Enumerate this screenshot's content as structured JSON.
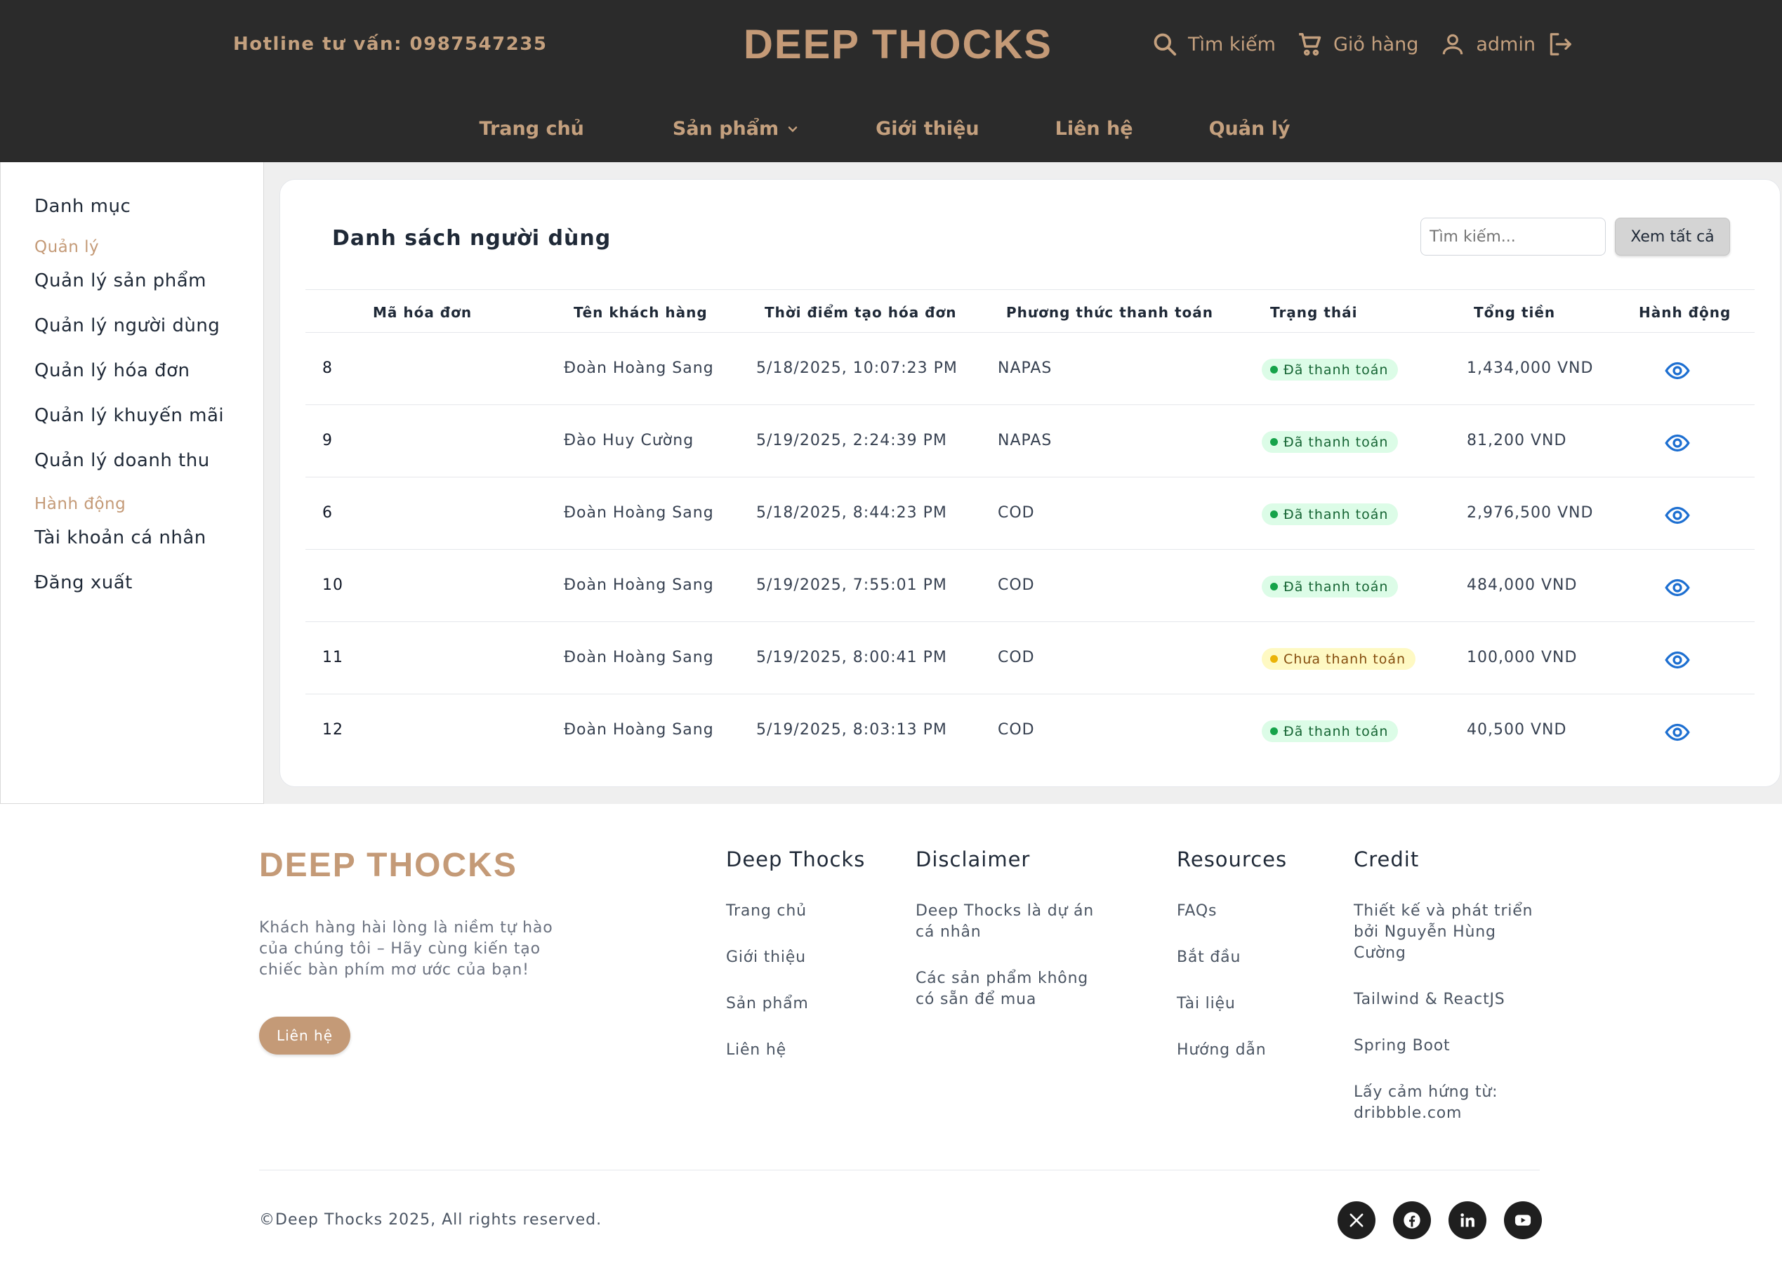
{
  "header": {
    "hotline_label": "Hotline tư vấn: ",
    "hotline_number": "0987547235",
    "brand": "DEEP THOCKS",
    "search_label": "Tìm kiếm",
    "cart_label": "Giỏ hàng",
    "user_label": "admin"
  },
  "nav": {
    "home": "Trang chủ",
    "products": "Sản phẩm",
    "about": "Giới thiệu",
    "contact": "Liên hệ",
    "manage": "Quản lý"
  },
  "sidebar": {
    "title": "Danh mục",
    "cat_manage": "Quản lý",
    "items": [
      "Quản lý sản phẩm",
      "Quản lý người dùng",
      "Quản lý hóa đơn",
      "Quản lý khuyến mãi",
      "Quản lý doanh thu"
    ],
    "cat_actions": "Hành động",
    "actions": [
      "Tài khoản cá nhân",
      "Đăng xuất"
    ]
  },
  "main": {
    "title": "Danh sách người dùng",
    "search_placeholder": "Tìm kiếm...",
    "view_all": "Xem tất cả",
    "columns": [
      "Mã hóa đơn",
      "Tên khách hàng",
      "Thời điểm tạo hóa đơn",
      "Phương thức thanh toán",
      "Trạng thái",
      "Tổng tiền",
      "Hành động"
    ],
    "rows": [
      {
        "id": "8",
        "customer": "Đoàn Hoàng Sang",
        "created": "5/18/2025, 10:07:23 PM",
        "method": "NAPAS",
        "status": "Đã thanh toán",
        "paid": true,
        "total": "1,434,000 VND"
      },
      {
        "id": "9",
        "customer": "Đào Huy Cường",
        "created": "5/19/2025, 2:24:39 PM",
        "method": "NAPAS",
        "status": "Đã thanh toán",
        "paid": true,
        "total": "81,200 VND"
      },
      {
        "id": "6",
        "customer": "Đoàn Hoàng Sang",
        "created": "5/18/2025, 8:44:23 PM",
        "method": "COD",
        "status": "Đã thanh toán",
        "paid": true,
        "total": "2,976,500 VND"
      },
      {
        "id": "10",
        "customer": "Đoàn Hoàng Sang",
        "created": "5/19/2025, 7:55:01 PM",
        "method": "COD",
        "status": "Đã thanh toán",
        "paid": true,
        "total": "484,000 VND"
      },
      {
        "id": "11",
        "customer": "Đoàn Hoàng Sang",
        "created": "5/19/2025, 8:00:41 PM",
        "method": "COD",
        "status": "Chưa thanh toán",
        "paid": false,
        "total": "100,000 VND"
      },
      {
        "id": "12",
        "customer": "Đoàn Hoàng Sang",
        "created": "5/19/2025, 8:03:13 PM",
        "method": "COD",
        "status": "Đã thanh toán",
        "paid": true,
        "total": "40,500 VND"
      }
    ]
  },
  "footer": {
    "brand": "DEEP THOCKS",
    "description": "Khách hàng hài lòng là niềm tự hào của chúng tôi – Hãy cùng kiến tạo chiếc bàn phím mơ ước của bạn!",
    "contact_button": "Liên hệ",
    "columns": [
      {
        "title": "Deep Thocks",
        "links": [
          "Trang chủ",
          "Giới thiệu",
          "Sản phẩm",
          "Liên hệ"
        ]
      },
      {
        "title": "Disclaimer",
        "links": [
          "Deep Thocks là dự án cá nhân",
          "Các sản phẩm không có sẵn để mua"
        ]
      },
      {
        "title": "Resources",
        "links": [
          "FAQs",
          "Bắt đầu",
          "Tài liệu",
          "Hướng dẫn"
        ]
      },
      {
        "title": "Credit",
        "links": [
          "Thiết kế và phát triển bởi Nguyễn Hùng Cường",
          "Tailwind & ReactJS",
          "Spring Boot",
          "Lấy cảm hứng từ: dribbble.com"
        ]
      }
    ],
    "copyright": "©Deep Thocks 2025, All rights reserved.",
    "socials": [
      "x-icon",
      "facebook-icon",
      "linkedin-icon",
      "youtube-icon"
    ]
  },
  "colors": {
    "header_bg": "#2b2b2b",
    "accent": "#c49a77",
    "paid_bg": "#dcfce7",
    "unpaid_bg": "#fef9c3",
    "eye_icon": "#1d6fd1"
  }
}
